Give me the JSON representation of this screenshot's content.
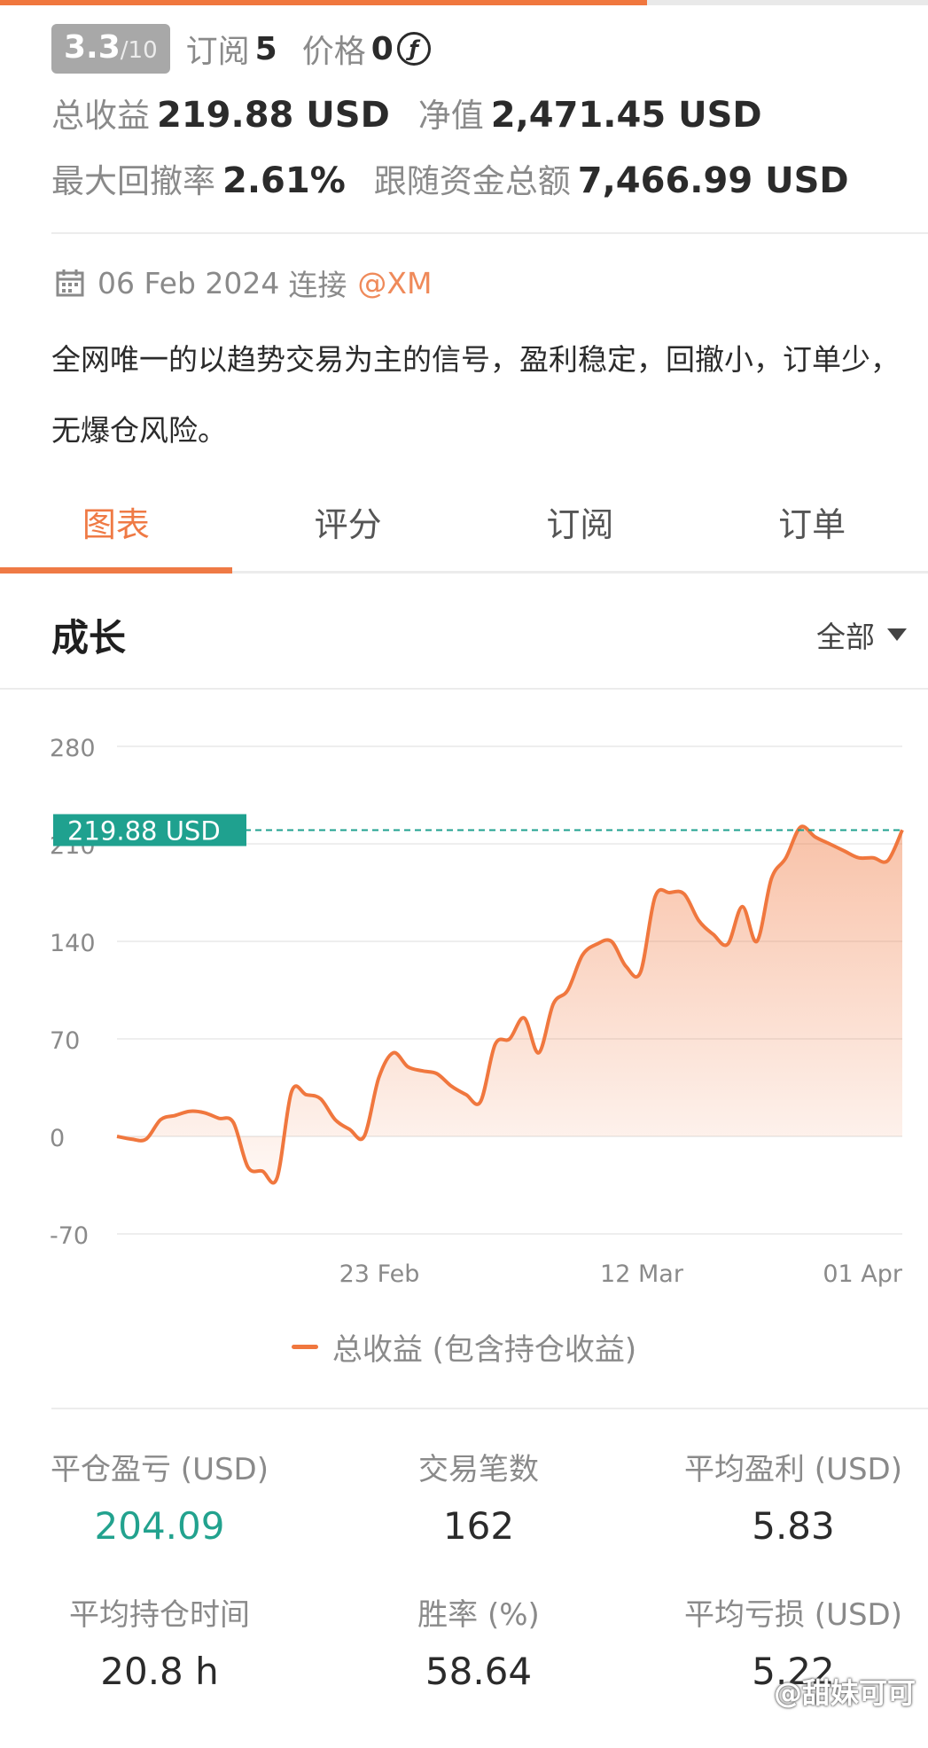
{
  "header": {
    "rating": {
      "value": "3.3",
      "max": "/10"
    },
    "subscribe": {
      "label": "订阅",
      "value": "5"
    },
    "price": {
      "label": "价格",
      "value": "0"
    },
    "total_profit": {
      "label": "总收益",
      "value": "219.88 USD"
    },
    "equity": {
      "label": "净值",
      "value": "2,471.45 USD"
    },
    "max_drawdown": {
      "label": "最大回撤率",
      "value": "2.61%"
    },
    "follow_funds": {
      "label": "跟随资金总额",
      "value": "7,466.99 USD"
    }
  },
  "connection": {
    "date": "06 Feb 2024",
    "label": "连接",
    "broker": "@XM",
    "icon": "calendar-icon"
  },
  "description": "全网唯一的以趋势交易为主的信号，盈利稳定，回撤小，订单少，无爆仓风险。",
  "tabs": [
    {
      "label": "图表",
      "active": true
    },
    {
      "label": "评分",
      "active": false
    },
    {
      "label": "订阅",
      "active": false
    },
    {
      "label": "订单",
      "active": false
    }
  ],
  "growth": {
    "title": "成长",
    "range_label": "全部"
  },
  "chart_data": {
    "type": "area",
    "series": [
      {
        "name": "总收益 (包含持仓收益)",
        "color": "#f0773e",
        "values": [
          0,
          -2,
          -2,
          12,
          15,
          18,
          17,
          13,
          10,
          -22,
          -25,
          -30,
          32,
          30,
          27,
          12,
          5,
          0,
          42,
          60,
          50,
          47,
          45,
          36,
          30,
          25,
          66,
          70,
          85,
          60,
          95,
          105,
          130,
          138,
          140,
          122,
          118,
          172,
          175,
          174,
          155,
          145,
          138,
          165,
          140,
          185,
          200,
          222,
          215,
          210,
          205,
          200,
          200,
          198,
          220
        ]
      }
    ],
    "x_ticks": [
      "23 Feb",
      "12 Mar",
      "01 Apr"
    ],
    "y_ticks": [
      "280",
      "210",
      "140",
      "70",
      "0",
      "-70"
    ],
    "ylim": [
      -70,
      280
    ],
    "last_value_label": "219.88 USD",
    "last_value": 219.88,
    "accent_color": "#1fa18f"
  },
  "metrics": [
    {
      "label": "平仓盈亏 (USD)",
      "value": "204.09",
      "highlight": true
    },
    {
      "label": "交易笔数",
      "value": "162",
      "highlight": false
    },
    {
      "label": "平均盈利 (USD)",
      "value": "5.83",
      "highlight": false
    },
    {
      "label": "平均持仓时间",
      "value": "20.8 h",
      "highlight": false
    },
    {
      "label": "胜率 (%)",
      "value": "58.64",
      "highlight": false
    },
    {
      "label": "平均亏损 (USD)",
      "value": "5.22",
      "highlight": false
    }
  ],
  "watermark": "@甜妹可可"
}
